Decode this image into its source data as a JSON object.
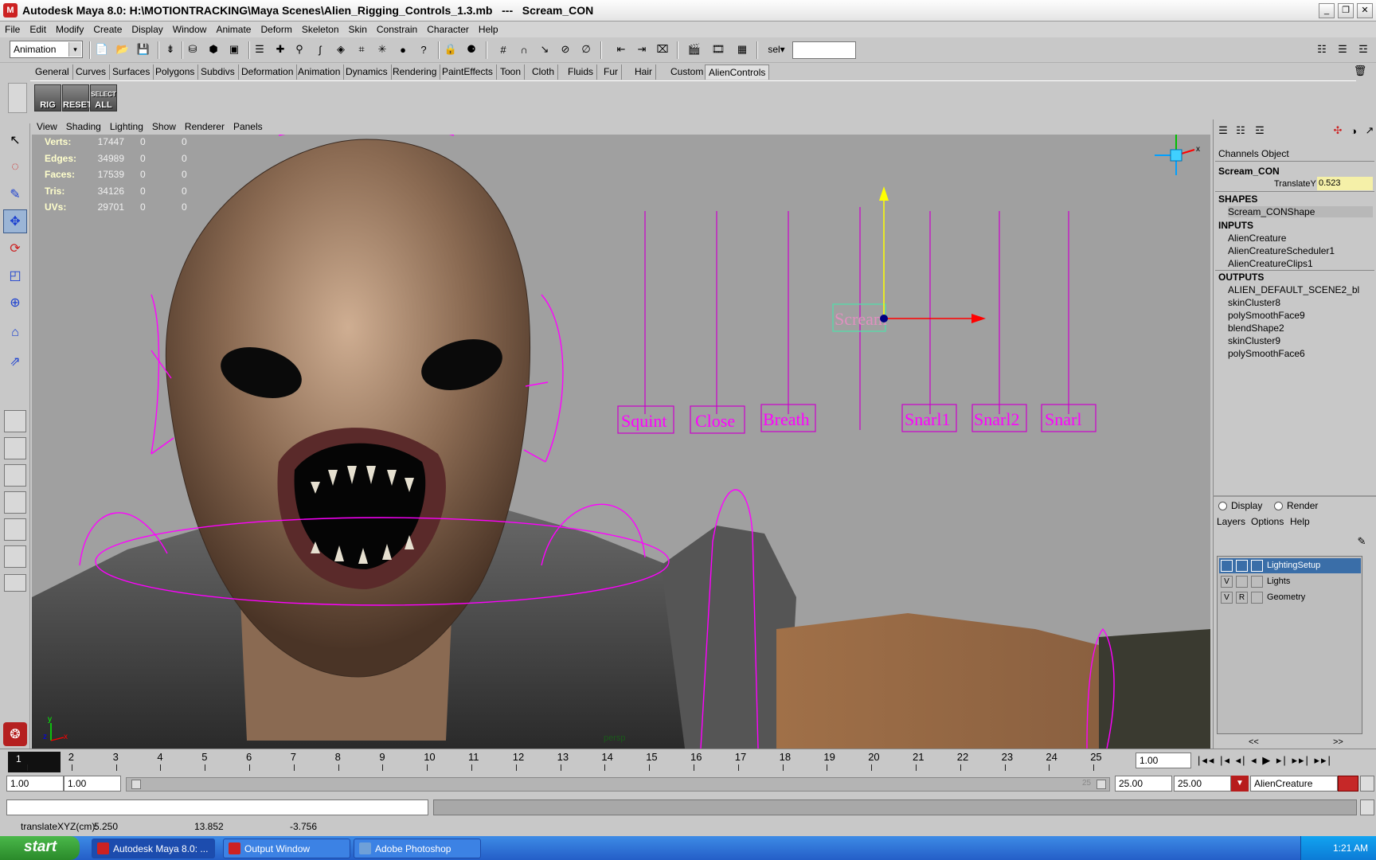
{
  "window": {
    "title": "Autodesk Maya 8.0: H:\\MOTIONTRACKING\\Maya Scenes\\Alien_Rigging_Controls_1.3.mb   ---   Scream_CON",
    "logo": "M",
    "min": "_",
    "restore": "❐",
    "close": "✕"
  },
  "menubar": [
    "File",
    "Edit",
    "Modify",
    "Create",
    "Display",
    "Window",
    "Animate",
    "Deform",
    "Skeleton",
    "Skin",
    "Constrain",
    "Character",
    "Help"
  ],
  "statusline": {
    "mode": "Animation",
    "mode_arrow": "▾",
    "sel_label": "sel▾"
  },
  "shelf_tabs": [
    "General",
    "Curves",
    "Surfaces",
    "Polygons",
    "Subdivs",
    "Deformation",
    "Animation",
    "Dynamics",
    "Rendering",
    "PaintEffects",
    "Toon",
    "Cloth",
    "Fluids",
    "Fur",
    "Hair",
    "Custom",
    "AlienControls"
  ],
  "shelf_icons": [
    {
      "label": "RIG"
    },
    {
      "label": "RESET"
    },
    {
      "label": "ALL",
      "sub": "SELECT"
    }
  ],
  "viewport": {
    "menu": [
      "View",
      "Shading",
      "Lighting",
      "Show",
      "Renderer",
      "Panels"
    ],
    "hud": [
      {
        "label": "Verts:",
        "value": "17447",
        "a": "0",
        "b": "0"
      },
      {
        "label": "Edges:",
        "value": "34989",
        "a": "0",
        "b": "0"
      },
      {
        "label": "Faces:",
        "value": "17539",
        "a": "0",
        "b": "0"
      },
      {
        "label": "Tris:",
        "value": "34126",
        "a": "0",
        "b": "0"
      },
      {
        "label": "UVs:",
        "value": "29701",
        "a": "0",
        "b": "0"
      }
    ],
    "camera_label": "persp",
    "axis_y": "y",
    "axis_x": "x",
    "axis_z": "z",
    "controls": [
      "Squint",
      "Close",
      "Breath",
      "Snarl1",
      "Snarl2",
      "Snarl"
    ],
    "scream_label": "Scream"
  },
  "channelbox": {
    "tabs": [
      "Channels",
      "Object"
    ],
    "object": "Scream_CON",
    "attr_label": "TranslateY",
    "attr_value": "0.523",
    "shapes_header": "SHAPES",
    "shape": "Scream_CONShape",
    "inputs_header": "INPUTS",
    "inputs": [
      "AlienCreature",
      "AlienCreatureScheduler1",
      "AlienCreatureClips1"
    ],
    "outputs_header": "OUTPUTS",
    "outputs": [
      "ALIEN_DEFAULT_SCENE2_bl",
      "skinCluster8",
      "polySmoothFace9",
      "blendShape2",
      "skinCluster9",
      "polySmoothFace6"
    ]
  },
  "layereditor": {
    "display": "Display",
    "render": "Render",
    "menu": [
      "Layers",
      "Options",
      "Help"
    ],
    "layers": [
      {
        "v": "",
        "r": "",
        "name": "LightingSetup"
      },
      {
        "v": "V",
        "r": "",
        "name": "Lights"
      },
      {
        "v": "V",
        "r": "R",
        "name": "Geometry"
      }
    ],
    "scroll_left": "<<",
    "scroll_right": ">>"
  },
  "timeline": {
    "current_frame": "1",
    "frames": [
      "1",
      "2",
      "3",
      "4",
      "5",
      "6",
      "7",
      "8",
      "9",
      "10",
      "11",
      "12",
      "13",
      "14",
      "15",
      "16",
      "17",
      "18",
      "19",
      "20",
      "21",
      "22",
      "23",
      "24",
      "25"
    ],
    "current_time": "1.00",
    "start_time": "1.00",
    "start_playback": "1.00",
    "end_playback": "25.00",
    "end_time": "25.00",
    "range_end_label": "25",
    "character": "AlienCreature",
    "play_buttons": [
      "|◂◂",
      "|◂",
      "◂|",
      "◂",
      "▶",
      "▸|",
      "▸▸|",
      "▸▸|"
    ]
  },
  "helpline": {
    "text": "translateXYZ(cm):",
    "x": "5.250",
    "y": "13.852",
    "z": "-3.756"
  },
  "taskbar": {
    "start": "start",
    "tasks": [
      "Autodesk Maya 8.0: ...",
      "Output Window",
      "Adobe Photoshop"
    ],
    "clock": "1:21 AM"
  },
  "colors": {
    "accent": "#3a6ea8",
    "control_magenta": "#ff00ff",
    "viewport_bg": "#a0a0a0",
    "attr_highlight": "#f5f0a8"
  }
}
